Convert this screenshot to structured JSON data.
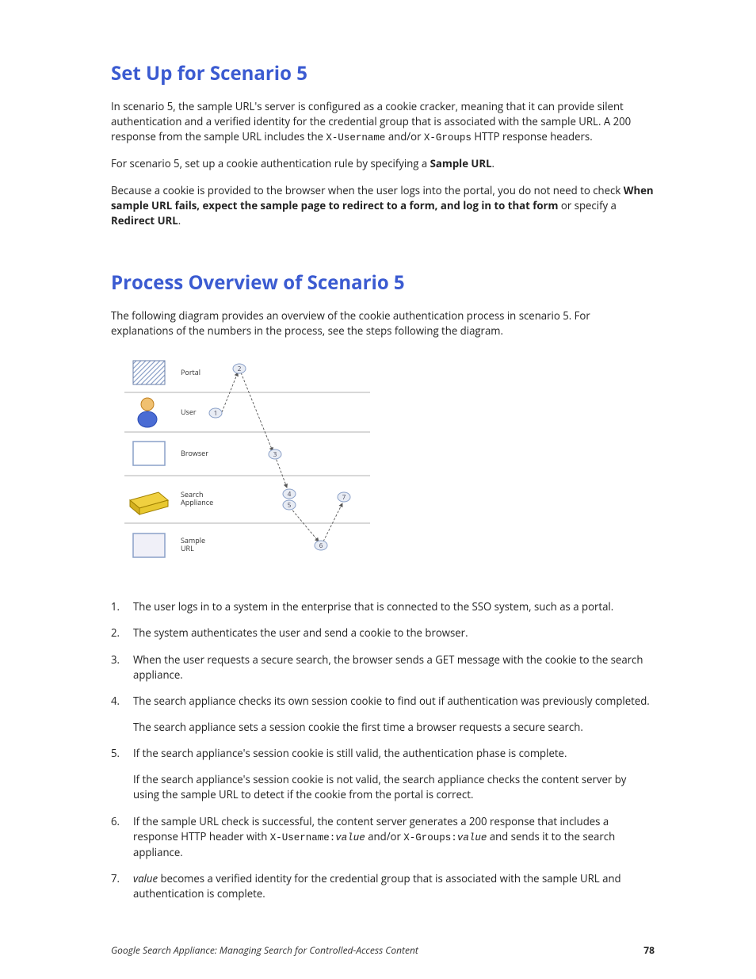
{
  "section1": {
    "heading": "Set Up for Scenario 5",
    "p1a": "In scenario 5, the sample URL's server is configured as a cookie cracker, meaning that it can provide silent authentication and a verified identity for the credential group that is associated with the sample URL. A 200 response from the sample URL includes the ",
    "p1_code1": "X-Username",
    "p1b": " and/or ",
    "p1_code2": "X-Groups",
    "p1c": " HTTP response headers.",
    "p2a": "For scenario 5, set up a cookie authentication rule by specifying a ",
    "p2_bold": "Sample URL",
    "p2b": ".",
    "p3a": "Because a cookie is provided to the browser when the user logs into the portal, you do not need to check ",
    "p3_bold1": "When sample URL fails, expect the sample page to redirect to a form, and log in to that form",
    "p3b": " or specify a ",
    "p3_bold2": "Redirect URL",
    "p3c": "."
  },
  "section2": {
    "heading": "Process Overview of Scenario 5",
    "intro": "The following diagram provides an overview of the cookie authentication process in scenario 5. For explanations of the numbers in the process, see the steps following the diagram."
  },
  "diagram": {
    "rows": [
      "Portal",
      "User",
      "Browser",
      "Search\nAppliance",
      "Sample\nURL"
    ],
    "bubbles": [
      "1",
      "2",
      "3",
      "4",
      "5",
      "6",
      "7"
    ]
  },
  "steps": {
    "s1": "The user logs in to a system in the enterprise that is connected to the SSO system, such as a portal.",
    "s2": "The system authenticates the user and send a cookie to the browser.",
    "s3": "When the user requests a secure search, the browser sends a GET message with the cookie to the search appliance.",
    "s4a": "The search appliance checks its own session cookie to find out if authentication was previously completed.",
    "s4b": "The search appliance sets a session cookie the first time a browser requests a secure search.",
    "s5a": "If the search appliance's session cookie is still valid, the authentication phase is complete.",
    "s5b": "If the search appliance's session cookie is not valid, the search appliance checks the content server by using the sample URL to detect if the cookie from the portal is correct.",
    "s6a": "If the sample URL check is successful, the content server generates a 200 response that includes a response HTTP header with ",
    "s6_code1": "X-Username:",
    "s6_val1": "value",
    "s6b": " and/or ",
    "s6_code2": "X-Groups:",
    "s6_val2": "value",
    "s6c": " and sends it to the search appliance.",
    "s7_i": "value",
    "s7a": " becomes a verified identity for the credential group that is associated with the sample URL and authentication is complete."
  },
  "footer": {
    "title": "Google Search Appliance: Managing Search for Controlled-Access Content",
    "page": "78"
  }
}
